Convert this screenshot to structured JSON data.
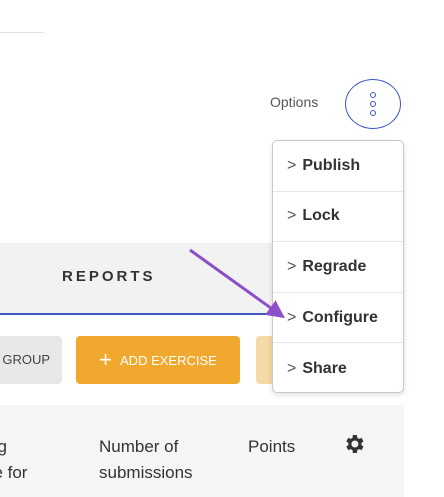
{
  "options": {
    "label": "Options"
  },
  "tabs": [
    {
      "label": "REPORTS"
    }
  ],
  "actions": {
    "group_label": "GROUP",
    "add_exercise_label": "ADD EXERCISE",
    "add_icon": "+"
  },
  "table": {
    "columns": [
      {
        "line1": "ng",
        "line2": "ne for"
      },
      {
        "line1": "Number of",
        "line2": "submissions"
      },
      {
        "line1": "Points"
      }
    ],
    "settings_icon": "gear-icon"
  },
  "menu": {
    "items": [
      {
        "label": "Publish"
      },
      {
        "label": "Lock"
      },
      {
        "label": "Regrade"
      },
      {
        "label": "Configure"
      },
      {
        "label": "Share"
      }
    ],
    "chevron": ">"
  },
  "colors": {
    "accent": "#3d57c7",
    "orange": "#f0a92e",
    "annotation_arrow": "#8b4fc9"
  }
}
